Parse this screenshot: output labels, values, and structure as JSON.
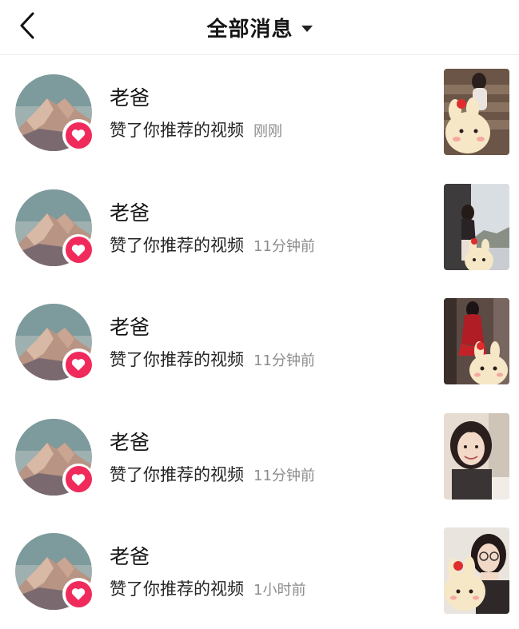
{
  "header": {
    "title": "全部消息",
    "back_icon": "chevron-left-icon",
    "dropdown_icon": "caret-down-icon"
  },
  "colors": {
    "like_badge": "#f02b5c",
    "time_text": "#8c8c8c"
  },
  "messages": [
    {
      "name": "老爸",
      "action": "赞了你推荐的视频",
      "time": "刚刚",
      "thumb_theme": "girl-with-bear-on-stairs"
    },
    {
      "name": "老爸",
      "action": "赞了你推荐的视频",
      "time": "11分钟前",
      "thumb_theme": "girl-at-window"
    },
    {
      "name": "老爸",
      "action": "赞了你推荐的视频",
      "time": "11分钟前",
      "thumb_theme": "girl-in-red-dress"
    },
    {
      "name": "老爸",
      "action": "赞了你推荐的视频",
      "time": "11分钟前",
      "thumb_theme": "smiling-girl-selfie"
    },
    {
      "name": "老爸",
      "action": "赞了你推荐的视频",
      "time": "1小时前",
      "thumb_theme": "girl-with-glasses-and-bear"
    }
  ]
}
